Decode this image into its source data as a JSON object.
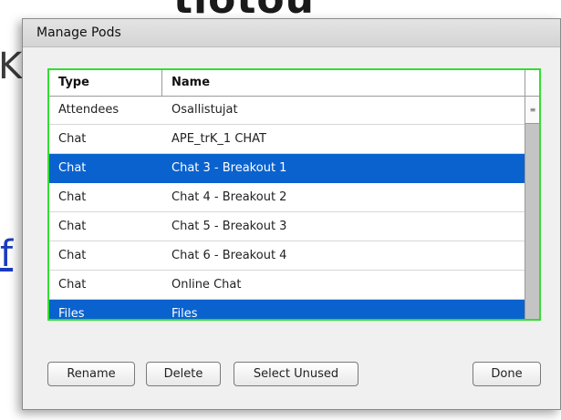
{
  "dialog": {
    "title": "Manage Pods"
  },
  "grid": {
    "columns": {
      "type": "Type",
      "name": "Name"
    },
    "rows": [
      {
        "type": "Attendees",
        "name": "Osallistujat",
        "selected": false
      },
      {
        "type": "Chat",
        "name": "APE_trK_1 CHAT",
        "selected": false
      },
      {
        "type": "Chat",
        "name": "Chat 3 - Breakout 1",
        "selected": true
      },
      {
        "type": "Chat",
        "name": "Chat 4 - Breakout 2",
        "selected": false
      },
      {
        "type": "Chat",
        "name": "Chat 5 - Breakout 3",
        "selected": false
      },
      {
        "type": "Chat",
        "name": "Chat 6 - Breakout 4",
        "selected": false
      },
      {
        "type": "Chat",
        "name": "Online Chat",
        "selected": false
      },
      {
        "type": "Files",
        "name": "Files",
        "selected": true
      }
    ],
    "focus_color": "#33dd33",
    "selection_color": "#0a62cf"
  },
  "buttons": {
    "rename": "Rename",
    "delete": "Delete",
    "select_unused": "Select Unused",
    "done": "Done"
  },
  "icons": {
    "scroll_grip": "grip-icon"
  }
}
